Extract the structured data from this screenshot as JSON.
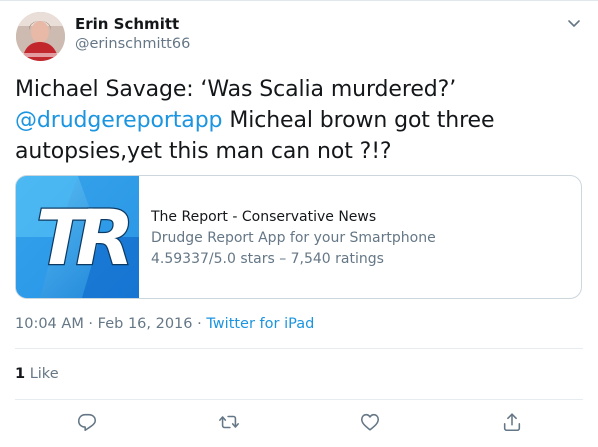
{
  "author": {
    "name": "Erin Schmitt",
    "handle": "@erinschmitt66"
  },
  "tweet": {
    "text_before": "Michael Savage: ‘Was Scalia murdered?’ ",
    "mention": "@drudgereportapp",
    "text_after": " Micheal brown got three autopsies,yet this man can not ?!?"
  },
  "card": {
    "logo_text": "TR",
    "title": "The Report - Conservative News",
    "description": "Drudge Report App for your Smartphone",
    "rating": "4.59337/5.0 stars – 7,540 ratings"
  },
  "meta": {
    "time": "10:04 AM",
    "separator1": " · ",
    "date": "Feb 16, 2016",
    "separator2": " · ",
    "source": "Twitter for iPad"
  },
  "likes": {
    "count": "1",
    "label": " Like"
  },
  "colors": {
    "link": "#1b95e0",
    "secondary_text": "#657786",
    "border": "#ccd6dd",
    "logo_blue": "#2aa8f2"
  },
  "icons": [
    "chevron-down-icon",
    "reply-icon",
    "retweet-icon",
    "like-icon",
    "share-icon"
  ]
}
